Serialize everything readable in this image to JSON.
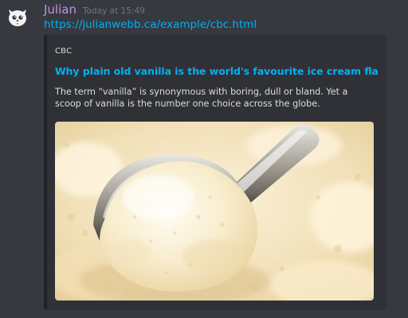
{
  "message": {
    "username": "Julian",
    "timestamp": "Today at 15:49",
    "link_text": "https://julianwebb.ca/example/cbc.html"
  },
  "embed": {
    "provider": "CBC",
    "title": "Why plain old vanilla is the world's favourite ice cream flavour | ...",
    "description": "The term “vanilla” is synonymous with boring, dull or bland. Yet a scoop of vanilla is the number one choice across the globe.",
    "image_icon": "ice-cream-photo"
  },
  "colors": {
    "background": "#36393f",
    "embed_background": "#2f3136",
    "username": "#c190e3",
    "link": "#00b0f4"
  }
}
